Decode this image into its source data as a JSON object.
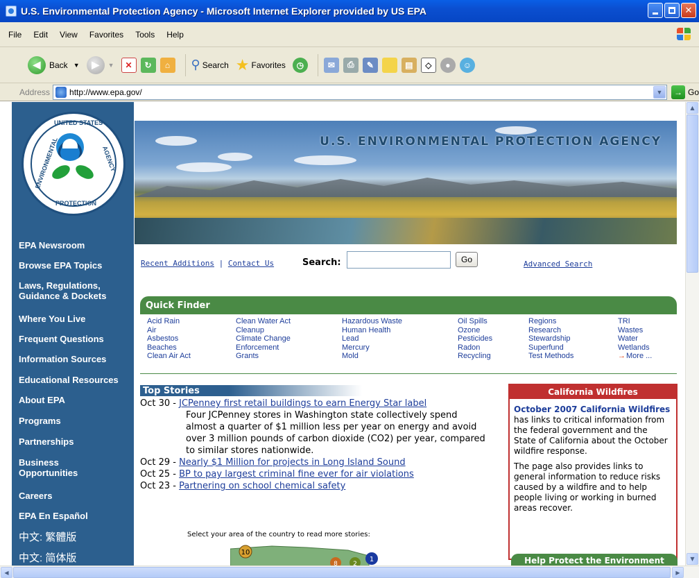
{
  "window": {
    "title": "U.S. Environmental Protection Agency - Microsoft Internet Explorer provided by US EPA"
  },
  "menu": [
    "File",
    "Edit",
    "View",
    "Favorites",
    "Tools",
    "Help"
  ],
  "toolbar": {
    "back_label": "Back",
    "search_label": "Search",
    "favorites_label": "Favorites"
  },
  "address": {
    "label": "Address",
    "url": "http://www.epa.gov/",
    "go_label": "Go"
  },
  "nav": {
    "seal_text_top": "UNITED STATES",
    "seal_text_left": "ENVIRONMENTAL",
    "seal_text_right": "AGENCY",
    "seal_text_bottom": "PROTECTION",
    "items": [
      {
        "label": "EPA Newsroom"
      },
      {
        "label": "Browse EPA Topics"
      },
      {
        "label": "Laws, Regulations,",
        "label2": " Guidance & Dockets"
      },
      {
        "label": "Where You Live"
      },
      {
        "label": "Frequent Questions"
      },
      {
        "label": "Information Sources"
      },
      {
        "label": "Educational Resources"
      },
      {
        "label": "About EPA"
      },
      {
        "label": "Programs"
      },
      {
        "label": "Partnerships"
      },
      {
        "label": "Business",
        "label2": " Opportunities"
      },
      {
        "label": "Careers"
      },
      {
        "label": "EPA En Español"
      },
      {
        "label": "中文: 繁體版"
      },
      {
        "label": "中文: 简体版"
      }
    ]
  },
  "banner": {
    "title": "U.S. ENVIRONMENTAL PROTECTION AGENCY"
  },
  "toplinks": {
    "recent": "Recent Additions",
    "divider": " | ",
    "contact": "Contact Us",
    "search_label": "Search:",
    "search_value": "",
    "go_label": "Go",
    "advanced": "Advanced Search"
  },
  "quickfinder": {
    "title": "Quick Finder",
    "columns": [
      [
        "Acid Rain",
        "Air",
        "Asbestos",
        "Beaches",
        "Clean Air Act"
      ],
      [
        "Clean Water Act",
        "Cleanup",
        "Climate Change",
        "Enforcement",
        "Grants"
      ],
      [
        "Hazardous Waste",
        "Human Health",
        "Lead",
        "Mercury",
        "Mold"
      ],
      [
        "Oil Spills",
        "Ozone",
        "Pesticides",
        "Radon",
        "Recycling"
      ],
      [
        "Regions",
        "Research",
        "Stewardship",
        "Superfund",
        "Test Methods"
      ],
      [
        "TRI",
        "Wastes",
        "Water",
        "Wetlands",
        "More ..."
      ]
    ]
  },
  "stories": {
    "title": "Top Stories",
    "items": [
      {
        "date": "Oct 30 - ",
        "link": "JCPenney first retail buildings to earn Energy Star label",
        "blurb": "Four JCPenney stores in Washington state collectively spend almost a quarter of $1 million less per year on energy and avoid over 3 million pounds of carbon dioxide (CO2) per year, compared to similar stores nationwide."
      },
      {
        "date": "Oct 29 - ",
        "link": "Nearly $1 Million for projects in Long Island Sound"
      },
      {
        "date": "Oct 25 - ",
        "link": "BP to pay largest criminal fine ever for air violations"
      },
      {
        "date": "Oct 23 - ",
        "link": "Partnering on school chemical safety"
      }
    ],
    "select_area": "Select your area of the country to read more stories:",
    "map_badges": [
      "10",
      "8",
      "2",
      "1"
    ]
  },
  "california": {
    "title": "California Wildfires",
    "link": "October 2007 California Wildfires",
    "text1": " has links to critical information from the federal government and the State of California about the October wildfire response.",
    "text2": "The page also provides links to general information to reduce risks caused by a wildfire and to help people living or working in burned areas recover."
  },
  "help": {
    "title": "Help Protect the Environment"
  },
  "colors": {
    "title_bar": "#0b4fd0",
    "nav_bg": "#2c5f8e",
    "quick_finder": "#4a8a45",
    "link": "#1d3d9a",
    "alert_red": "#c03030"
  }
}
